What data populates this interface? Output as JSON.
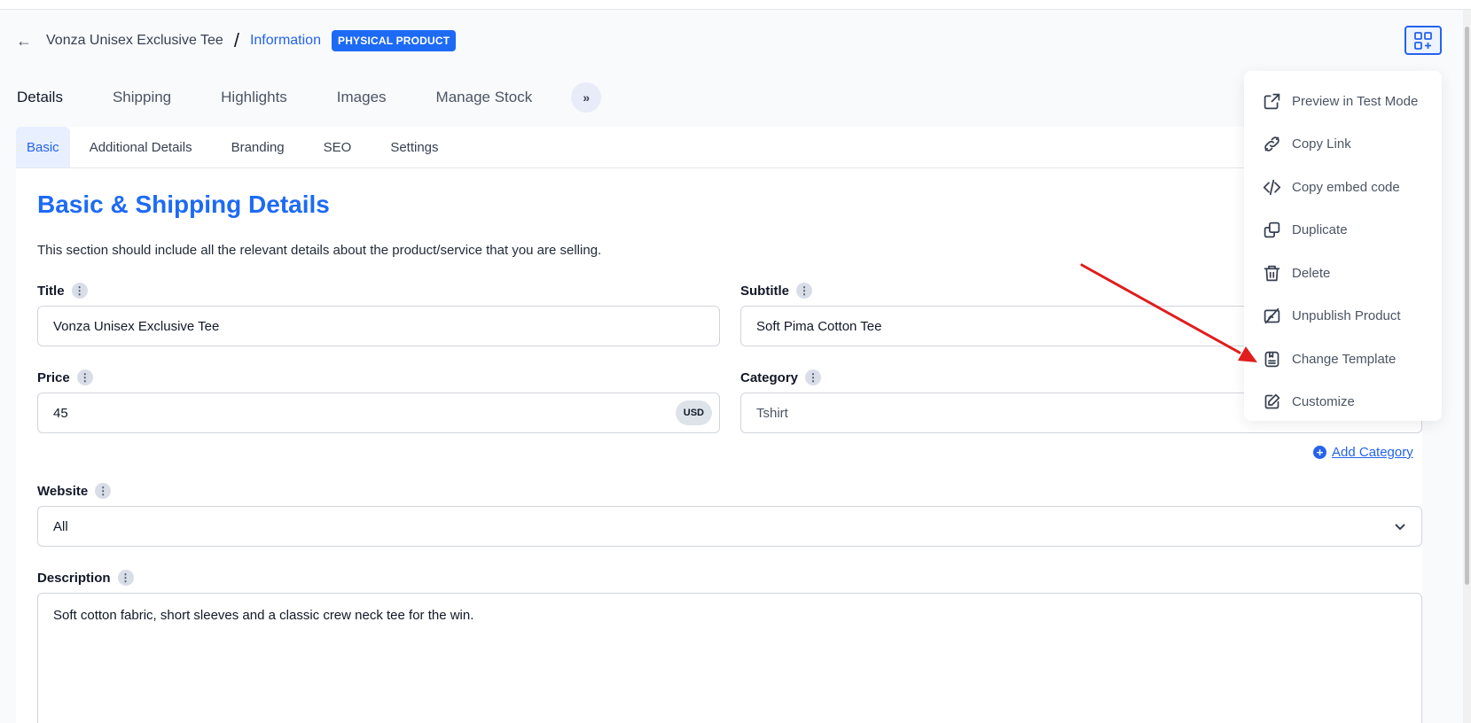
{
  "header": {
    "product_name": "Vonza Unisex Exclusive Tee",
    "separator": "/",
    "section": "Information",
    "badge": "PHYSICAL PRODUCT"
  },
  "main_tabs": [
    "Details",
    "Shipping",
    "Highlights",
    "Images",
    "Manage Stock"
  ],
  "more_label": "»",
  "sub_tabs": [
    "Basic",
    "Additional Details",
    "Branding",
    "SEO",
    "Settings"
  ],
  "section": {
    "title": "Basic & Shipping Details",
    "description": "This section should include all the relevant details about the product/service that you are selling."
  },
  "fields": {
    "title": {
      "label": "Title",
      "value": "Vonza Unisex Exclusive Tee"
    },
    "subtitle": {
      "label": "Subtitle",
      "value": "Soft Pima Cotton Tee"
    },
    "price": {
      "label": "Price",
      "value": "45",
      "currency": "USD"
    },
    "category": {
      "label": "Category",
      "value": "Tshirt"
    },
    "website": {
      "label": "Website",
      "value": "All"
    },
    "description": {
      "label": "Description",
      "value": "Soft cotton fabric, short sleeves and a classic crew neck tee for the win."
    }
  },
  "add_category": "Add Category",
  "menu": {
    "items": [
      {
        "label": "Preview in Test Mode",
        "icon": "external-link-icon"
      },
      {
        "label": "Copy Link",
        "icon": "link-icon"
      },
      {
        "label": "Copy embed code",
        "icon": "code-icon"
      },
      {
        "label": "Duplicate",
        "icon": "duplicate-icon"
      },
      {
        "label": "Delete",
        "icon": "trash-icon"
      },
      {
        "label": "Unpublish Product",
        "icon": "unpublish-icon"
      },
      {
        "label": "Change Template",
        "icon": "template-icon"
      },
      {
        "label": "Customize",
        "icon": "edit-icon"
      }
    ]
  },
  "colors": {
    "accent": "#1d6af5",
    "annotation_arrow": "#e11d1d"
  }
}
